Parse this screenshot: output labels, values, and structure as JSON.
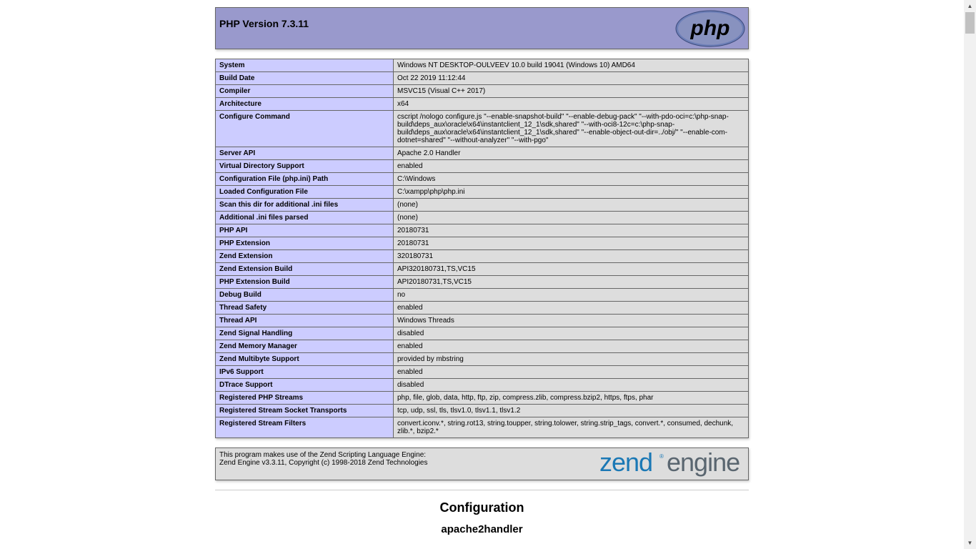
{
  "header": {
    "title": "PHP Version 7.3.11",
    "logo_text": "php"
  },
  "info_rows": [
    {
      "key": "System",
      "value": "Windows NT DESKTOP-OULVEEV 10.0 build 19041 (Windows 10) AMD64"
    },
    {
      "key": "Build Date",
      "value": "Oct 22 2019 11:12:44"
    },
    {
      "key": "Compiler",
      "value": "MSVC15 (Visual C++ 2017)"
    },
    {
      "key": "Architecture",
      "value": "x64"
    },
    {
      "key": "Configure Command",
      "value": "cscript /nologo configure.js \"--enable-snapshot-build\" \"--enable-debug-pack\" \"--with-pdo-oci=c:\\php-snap-build\\deps_aux\\oracle\\x64\\instantclient_12_1\\sdk,shared\" \"--with-oci8-12c=c:\\php-snap-build\\deps_aux\\oracle\\x64\\instantclient_12_1\\sdk,shared\" \"--enable-object-out-dir=../obj/\" \"--enable-com-dotnet=shared\" \"--without-analyzer\" \"--with-pgo\""
    },
    {
      "key": "Server API",
      "value": "Apache 2.0 Handler"
    },
    {
      "key": "Virtual Directory Support",
      "value": "enabled"
    },
    {
      "key": "Configuration File (php.ini) Path",
      "value": "C:\\Windows"
    },
    {
      "key": "Loaded Configuration File",
      "value": "C:\\xampp\\php\\php.ini"
    },
    {
      "key": "Scan this dir for additional .ini files",
      "value": "(none)"
    },
    {
      "key": "Additional .ini files parsed",
      "value": "(none)"
    },
    {
      "key": "PHP API",
      "value": "20180731"
    },
    {
      "key": "PHP Extension",
      "value": "20180731"
    },
    {
      "key": "Zend Extension",
      "value": "320180731"
    },
    {
      "key": "Zend Extension Build",
      "value": "API320180731,TS,VC15"
    },
    {
      "key": "PHP Extension Build",
      "value": "API20180731,TS,VC15"
    },
    {
      "key": "Debug Build",
      "value": "no"
    },
    {
      "key": "Thread Safety",
      "value": "enabled"
    },
    {
      "key": "Thread API",
      "value": "Windows Threads"
    },
    {
      "key": "Zend Signal Handling",
      "value": "disabled"
    },
    {
      "key": "Zend Memory Manager",
      "value": "enabled"
    },
    {
      "key": "Zend Multibyte Support",
      "value": "provided by mbstring"
    },
    {
      "key": "IPv6 Support",
      "value": "enabled"
    },
    {
      "key": "DTrace Support",
      "value": "disabled"
    },
    {
      "key": "Registered PHP Streams",
      "value": "php, file, glob, data, http, ftp, zip, compress.zlib, compress.bzip2, https, ftps, phar"
    },
    {
      "key": "Registered Stream Socket Transports",
      "value": "tcp, udp, ssl, tls, tlsv1.0, tlsv1.1, tlsv1.2"
    },
    {
      "key": "Registered Stream Filters",
      "value": "convert.iconv.*, string.rot13, string.toupper, string.tolower, string.strip_tags, convert.*, consumed, dechunk, zlib.*, bzip2.*"
    }
  ],
  "zend": {
    "line1": "This program makes use of the Zend Scripting Language Engine:",
    "line2": "Zend Engine v3.3.11, Copyright (c) 1998-2018 Zend Technologies",
    "logo_word1": "zend",
    "logo_mark": "®",
    "logo_word2": "engine"
  },
  "sections": {
    "configuration": "Configuration",
    "module": "apache2handler"
  },
  "colors": {
    "header_bg": "#9999cc",
    "key_bg": "#ccccff",
    "value_bg": "#dddddd",
    "zend_blue": "#1a78b5",
    "zend_gray": "#5a6670"
  },
  "icons": {
    "scroll_up": "triangle-up-icon",
    "scroll_down": "triangle-down-icon"
  }
}
